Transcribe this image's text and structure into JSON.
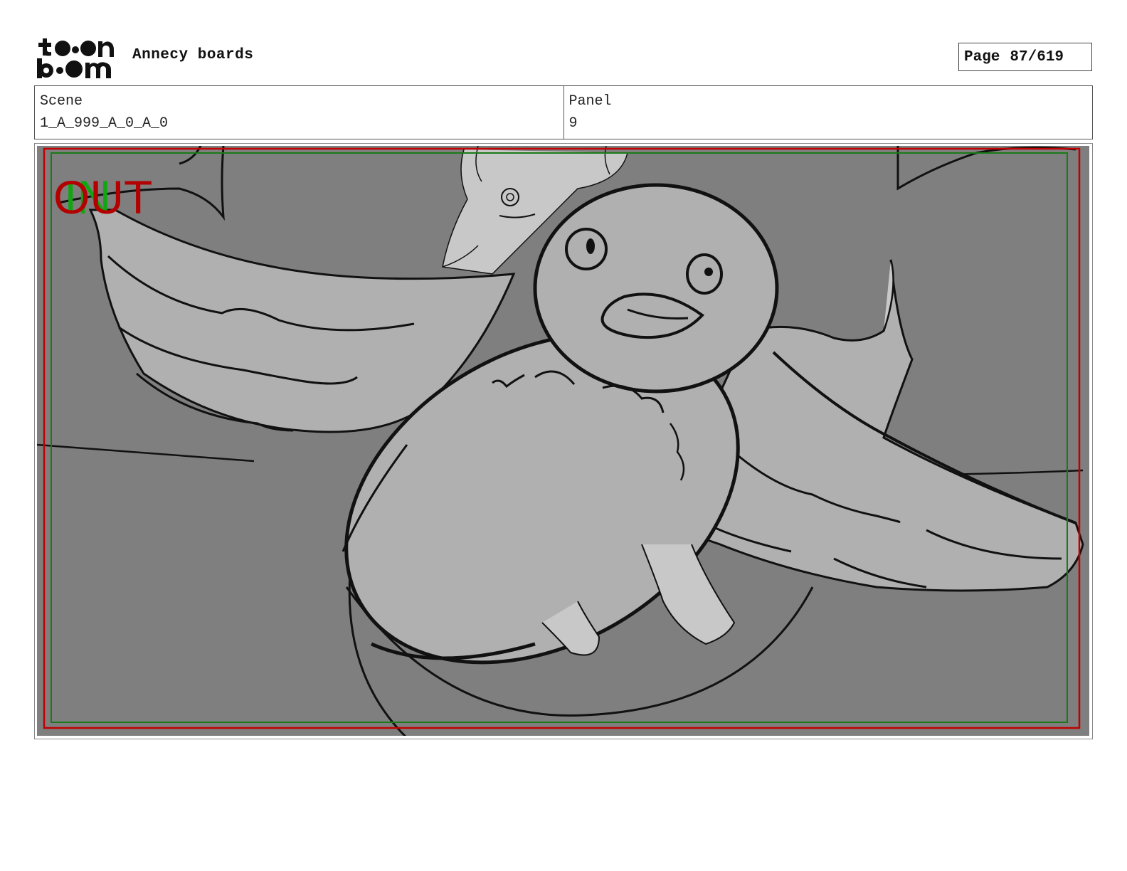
{
  "header": {
    "logo_text_top": "toon",
    "logo_text_bottom": "boom",
    "project_title": "Annecy boards",
    "page_label": "Page",
    "page_number": "87/619"
  },
  "info": {
    "scene_label": "Scene",
    "scene_value": "1_A_999_A_0_A_0",
    "panel_label": "Panel",
    "panel_value": "9"
  },
  "panel_image": {
    "overlay_out_text": "OUT",
    "overlay_in_text": "IN",
    "colors": {
      "background": "#7f7f7f",
      "bird_fill": "#b0b0b0",
      "character_fill": "#c8c8c8",
      "out_frame": "#c00000",
      "in_frame": "#1a7a1a"
    }
  }
}
